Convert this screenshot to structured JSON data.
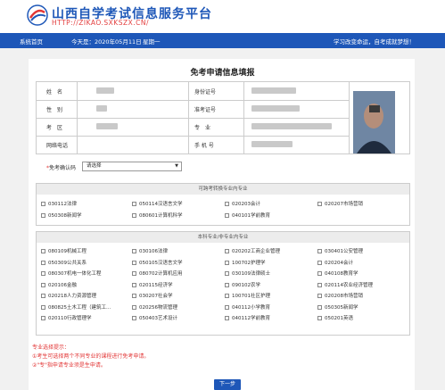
{
  "header": {
    "title": "山西自学考试信息服务平台",
    "url": "HTTP://ZIKAO.SXKSZX.CN/"
  },
  "navbar": {
    "home": "系统首页",
    "date_text": "今天是：2020年05月11日",
    "weekday": "星期一",
    "slogan": "学习改变命运，自考成就梦想！"
  },
  "form": {
    "title": "免考申请信息填报",
    "labels": {
      "name": "姓　名",
      "id_card": "身份证号",
      "gender": "性　别",
      "exam_no": "准考证号",
      "region": "考　区",
      "major": "专　业",
      "phone": "网络电话",
      "mobile": "手 机 号"
    },
    "exemption_label": "免考确认码",
    "exemption_required_mark": "*",
    "exemption_select_value": "请选择"
  },
  "sections": {
    "same_major_title": "可跨考转换专业内专业",
    "other_major_title": "本科专业/非专业内专业"
  },
  "same_major_items": [
    "030112法律",
    "050114汉语言文学",
    "020203会计",
    "020207市场营销",
    "050308新闻学",
    "080601计算机科学",
    "040101学前教育"
  ],
  "other_major_items": [
    "080109机械工程",
    "030106法律",
    "020202工商企业管理",
    "030401公安管理",
    "050309公共关系",
    "050105汉语言文学",
    "100702护理学",
    "020204会计",
    "080307机电一体化工程",
    "080702计算机应用",
    "030109法律硕士",
    "040108教育学",
    "020106金融",
    "020115经济学",
    "090102农学",
    "020114农业经济管理",
    "020218人力资源管理",
    "030207社会学",
    "100701社区护理",
    "020208市场营销",
    "080825土木工程（建筑工...",
    "020256物流管理",
    "040112小学教育",
    "050305新闻学",
    "020110行政管理学",
    "050403艺术设计",
    "040112学前教育",
    "050201英语"
  ],
  "hints": {
    "title": "专业选择提示：",
    "line1": "①考生可选择两个不同专业的课程进行免考申请。",
    "line2": "②\"专\"指申请专业须是生申请。"
  },
  "buttons": {
    "next": "下一步"
  },
  "colors": {
    "brand_blue": "#1e57b8",
    "accent_red": "#e23636"
  }
}
